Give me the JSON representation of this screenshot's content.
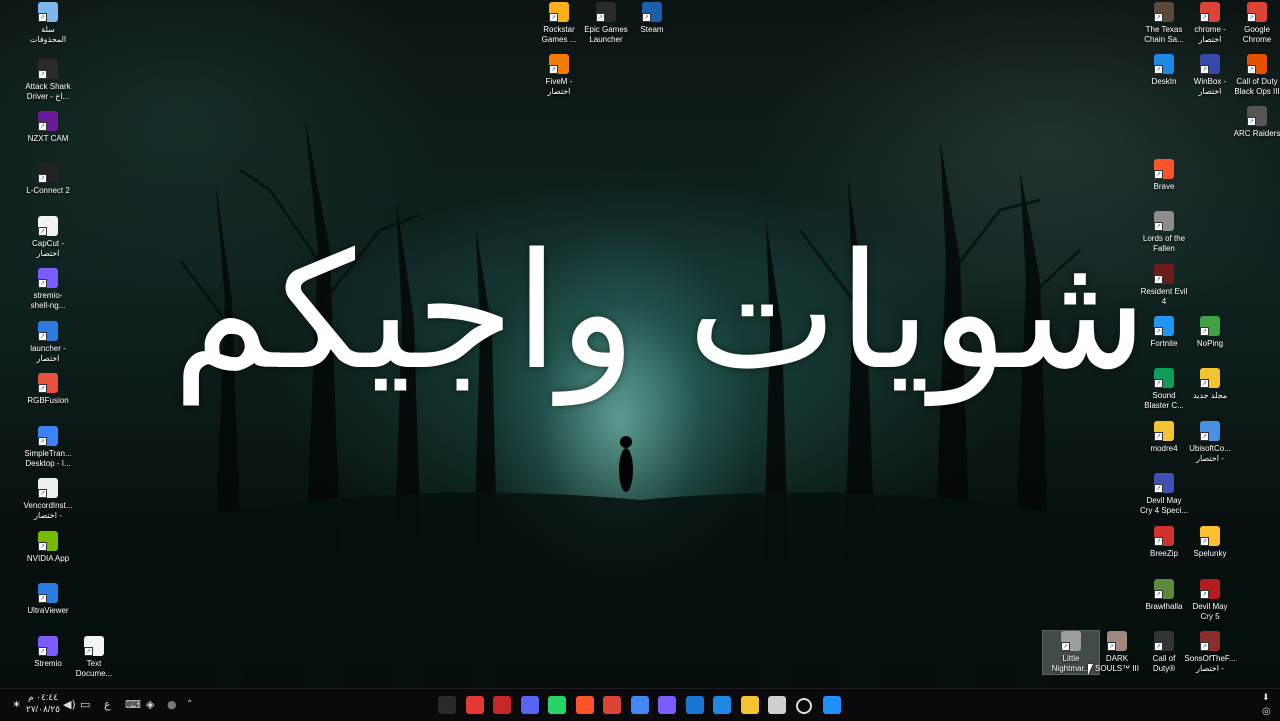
{
  "wallpaper": {
    "caption": "شويات واجيكم",
    "palette": [
      "#0f2321",
      "#63b8ad"
    ]
  },
  "desktop": {
    "icons": [
      {
        "label": "سلة\nالمحذوفات",
        "icon": "recycle-bin-icon",
        "color": "#7fb6e8"
      },
      {
        "label": "Attack Shark\nDriver - اخ...",
        "icon": "shortcut-icon",
        "color": "#2b2b2b"
      },
      {
        "label": "NZXT CAM",
        "icon": "nzxt-cam-icon",
        "color": "#6a1b9a"
      },
      {
        "label": "L-Connect 2",
        "icon": "shortcut-icon",
        "color": "#222222"
      },
      {
        "label": "CapCut -\nاختصار",
        "icon": "capcut-icon",
        "color": "#f2f2f2"
      },
      {
        "label": "stremio-\nshell-ng...",
        "icon": "stremio-icon",
        "color": "#7b5cff"
      },
      {
        "label": "launcher -\nاختصار",
        "icon": "launcher-icon",
        "color": "#2d7be0"
      },
      {
        "label": "RGBFusion",
        "icon": "rgbfusion-icon",
        "color": "#e84f3c"
      },
      {
        "label": "SimpleTran...\nDesktop - ا...",
        "icon": "simpletransfer-icon",
        "color": "#3b82f6"
      },
      {
        "label": "VencordInst...\nاختصار -",
        "icon": "vencord-icon",
        "color": "#eeeeee"
      },
      {
        "label": "NVIDIA App",
        "icon": "nvidia-icon",
        "color": "#76b900"
      },
      {
        "label": "UltraViewer",
        "icon": "ultraviewer-icon",
        "color": "#2a7de1"
      },
      {
        "label": "Stremio",
        "icon": "stremio-icon",
        "color": "#7b5cff"
      },
      {
        "label": "Text\nDocume...",
        "icon": "text-document-icon",
        "color": "#f4f4f4"
      },
      {
        "label": "Rockstar\nGames ...",
        "icon": "rockstar-icon",
        "color": "#fcaf17"
      },
      {
        "label": "Epic Games\nLauncher",
        "icon": "epic-games-icon",
        "color": "#2a2a2a"
      },
      {
        "label": "Steam",
        "icon": "steam-icon",
        "color": "#1b5fa8"
      },
      {
        "label": "FiveM -\nاختصار",
        "icon": "fivem-icon",
        "color": "#f57c00"
      },
      {
        "label": "The Texas\nChain Sa...",
        "icon": "game-icon",
        "color": "#5a4a3a"
      },
      {
        "label": "chrome -\nاختصار",
        "icon": "chrome-icon",
        "color": "#db4437"
      },
      {
        "label": "Google\nChrome",
        "icon": "chrome-icon",
        "color": "#db4437"
      },
      {
        "label": "DeskIn",
        "icon": "deskin-icon",
        "color": "#1e88e5"
      },
      {
        "label": "WinBox -\nاختصار",
        "icon": "winbox-icon",
        "color": "#3949ab"
      },
      {
        "label": "Call of Duty\nBlack Ops III",
        "icon": "cod-icon",
        "color": "#e65100"
      },
      {
        "label": "ARC Raiders",
        "icon": "arc-raiders-icon",
        "color": "#555555"
      },
      {
        "label": "Brave",
        "icon": "brave-icon",
        "color": "#fb542b"
      },
      {
        "label": "Lords of the\nFallen",
        "icon": "game-icon",
        "color": "#8d8d8d"
      },
      {
        "label": "Resident Evil\n4",
        "icon": "game-icon",
        "color": "#6d1b1b"
      },
      {
        "label": "Fortnite",
        "icon": "fortnite-icon",
        "color": "#2196f3"
      },
      {
        "label": "NoPing",
        "icon": "noping-icon",
        "color": "#43a047"
      },
      {
        "label": "Sound\nBlaster C...",
        "icon": "sound-blaster-icon",
        "color": "#0f9d58"
      },
      {
        "label": "مجلد جديد",
        "icon": "folder-icon",
        "color": "#f4c430"
      },
      {
        "label": "modre4",
        "icon": "folder-icon",
        "color": "#f4c430"
      },
      {
        "label": "UbisoftCo...\nاختصار -",
        "icon": "ubisoft-icon",
        "color": "#4a90e2"
      },
      {
        "label": "Devil May\nCry 4 Speci...",
        "icon": "game-icon",
        "color": "#3f51b5"
      },
      {
        "label": "BreeZip",
        "icon": "breezip-icon",
        "color": "#d32f2f"
      },
      {
        "label": "Spelunky",
        "icon": "spelunky-icon",
        "color": "#fbc02d"
      },
      {
        "label": "Brawlhalla",
        "icon": "brawlhalla-icon",
        "color": "#5c8a3a"
      },
      {
        "label": "Devil May\nCry 5",
        "icon": "game-icon",
        "color": "#b71c1c"
      },
      {
        "label": "Little\nNightmar...",
        "icon": "game-icon",
        "color": "#9e9e9e"
      },
      {
        "label": "DARK\nSOULS™ III",
        "icon": "game-icon",
        "color": "#a1887f"
      },
      {
        "label": "Call of\nDuty®",
        "icon": "cod-icon",
        "color": "#333333"
      },
      {
        "label": "SonsOfTheF...\nاختصار -",
        "icon": "game-icon",
        "color": "#8e2c2c"
      }
    ]
  },
  "taskbar": {
    "clock_time": "٠٤:٤٤ م",
    "clock_date": "٢٧/٠٨/٢٥",
    "lang": "ع",
    "tray_labels": [
      "wifi-icon",
      "volume-icon",
      "display-icon",
      "keyboard-icon",
      "defender-icon",
      "mic-icon",
      "chevron-up-icon"
    ],
    "pinned": [
      {
        "icon": "epic-games-icon",
        "color": "#2a2a2a"
      },
      {
        "icon": "speedometer-icon",
        "color": "#e53935"
      },
      {
        "icon": "media-app-icon",
        "color": "#c62828"
      },
      {
        "icon": "discord-icon",
        "color": "#5865f2"
      },
      {
        "icon": "whatsapp-icon",
        "color": "#25d366"
      },
      {
        "icon": "brave-icon",
        "color": "#fb542b"
      },
      {
        "icon": "chrome-icon",
        "color": "#db4437"
      },
      {
        "icon": "chrome-icon",
        "color": "#4285f4"
      },
      {
        "icon": "stremio-icon",
        "color": "#7b5cff"
      },
      {
        "icon": "remote-app-icon",
        "color": "#1976d2"
      },
      {
        "icon": "edge-icon",
        "color": "#1e88e5"
      },
      {
        "icon": "file-explorer-icon",
        "color": "#f4c430"
      },
      {
        "icon": "task-view-icon",
        "color": "#cfcfcf"
      },
      {
        "icon": "search-icon",
        "color": "#e0e0e0"
      },
      {
        "icon": "windows-start-icon",
        "color": "#1e90ff"
      }
    ]
  }
}
